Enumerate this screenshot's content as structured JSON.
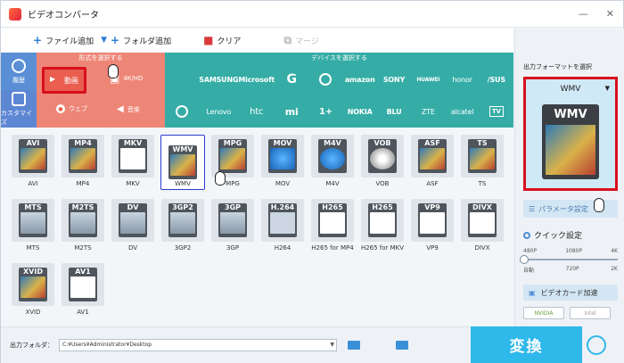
{
  "window": {
    "title": "ビデオコンバータ"
  },
  "toolbar": {
    "add_file": "ファイル追加",
    "add_folder": "フォルダ追加",
    "clear": "クリア",
    "merge": "マージ"
  },
  "sidebar": {
    "recent": "履歴",
    "custom": "カスタマイズ"
  },
  "format_panel": {
    "label": "形式を選択する",
    "categories": [
      "動画",
      "4K/HD",
      "ウェブ",
      "音楽"
    ]
  },
  "device_panel": {
    "label": "デバイスを選択する",
    "devices": [
      "",
      "SAMSUNG",
      "Microsoft",
      "G",
      "",
      "amazon",
      "SONY",
      "HUAWEI",
      "honor",
      "/SUS",
      "",
      "Lenovo",
      "htc",
      "mi",
      "1+",
      "NOKIA",
      "BLU",
      "ZTE",
      "alcatel",
      "TV"
    ]
  },
  "formats": [
    {
      "icon": "AVI",
      "label": "AVI"
    },
    {
      "icon": "MP4",
      "label": "MP4"
    },
    {
      "icon": "MKV",
      "label": "MKV"
    },
    {
      "icon": "WMV",
      "label": "WMV"
    },
    {
      "icon": "MPG",
      "label": "MPG"
    },
    {
      "icon": "MOV",
      "label": "MOV"
    },
    {
      "icon": "M4V",
      "label": "M4V"
    },
    {
      "icon": "VOB",
      "label": "VOB"
    },
    {
      "icon": "ASF",
      "label": "ASF"
    },
    {
      "icon": "TS",
      "label": "TS"
    },
    {
      "icon": "MTS",
      "label": "MTS"
    },
    {
      "icon": "M2TS",
      "label": "M2TS"
    },
    {
      "icon": "DV",
      "label": "DV"
    },
    {
      "icon": "3GP2",
      "label": "3GP2"
    },
    {
      "icon": "3GP",
      "label": "3GP"
    },
    {
      "icon": "H.264",
      "label": "H264"
    },
    {
      "icon": "H265",
      "label": "H265 for MP4"
    },
    {
      "icon": "H265",
      "label": "H265 for MKV"
    },
    {
      "icon": "VP9",
      "label": "VP9"
    },
    {
      "icon": "DIVX",
      "label": "DIVX"
    },
    {
      "icon": "XVID",
      "label": "XVID"
    },
    {
      "icon": "AV1",
      "label": "AV1"
    }
  ],
  "output_panel": {
    "title": "出力フォーマットを選択",
    "selected": "WMV",
    "icon_text": "WMV",
    "param_button": "パラメータ設定",
    "quick_label": "クイック設定",
    "ticks_top": [
      "480P",
      "1080P",
      "4K"
    ],
    "ticks_bottom": [
      "自動",
      "720P",
      "2K"
    ],
    "gpu_label": "ビデオカード加速",
    "gpu_logos": [
      "NVIDIA",
      "intel"
    ]
  },
  "bottom": {
    "output_folder_label": "出力フォルダ：",
    "output_folder_path": "C:¥Users¥Administrator¥Desktop",
    "convert_label": "変換"
  }
}
